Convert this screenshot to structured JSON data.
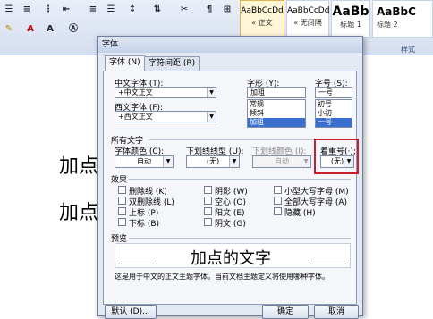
{
  "ribbon": {
    "styles": [
      {
        "sample": "AaBbCcDd",
        "name": "« 正文"
      },
      {
        "sample": "AaBbCcDd",
        "name": "« 无间隔"
      },
      {
        "sample": "AaBb",
        "name": "标题 1"
      },
      {
        "sample": "AaBbC",
        "name": "标题 2"
      }
    ],
    "styles_group_label": "样式"
  },
  "document": {
    "line1": "加点",
    "line2": "加点"
  },
  "dialog": {
    "title": "字体",
    "tabs": [
      "字体 (N)",
      "字符间距 (R)"
    ],
    "chinese_font_label": "中文字体 (T):",
    "chinese_font_value": "+中文正文",
    "western_font_label": "西文字体 (F):",
    "western_font_value": "+西文正文",
    "style_label": "字形 (Y):",
    "style_value": "加粗",
    "style_options": [
      "常规",
      "倾斜",
      "加粗"
    ],
    "size_label": "字号 (S):",
    "size_value": "一号",
    "size_options": [
      "初号",
      "小初",
      "一号"
    ],
    "all_text_label": "所有文字",
    "font_color_label": "字体颜色 (C):",
    "font_color_value": "自动",
    "underline_type_label": "下划线线型 (U):",
    "underline_type_value": "(无)",
    "underline_color_label": "下划线颜色 (I):",
    "underline_color_value": "自动",
    "emphasis_label": "着重号(·);",
    "emphasis_value": "(无)",
    "effects_label": "效果",
    "effects": [
      "删除线 (K)",
      "双删除线 (L)",
      "上标 (P)",
      "下标 (B)",
      "阴影 (W)",
      "空心 (O)",
      "阳文 (E)",
      "阴文 (G)",
      "小型大写字母 (M)",
      "全部大写字母 (A)",
      "隐藏 (H)"
    ],
    "preview_label": "预览",
    "preview_text": "加点的文字",
    "description": "这是用于中文的正文主题字体。当前文档主题定义将使用哪种字体。",
    "default_button": "默认 (D)...",
    "ok_button": "确定",
    "cancel_button": "取消"
  }
}
